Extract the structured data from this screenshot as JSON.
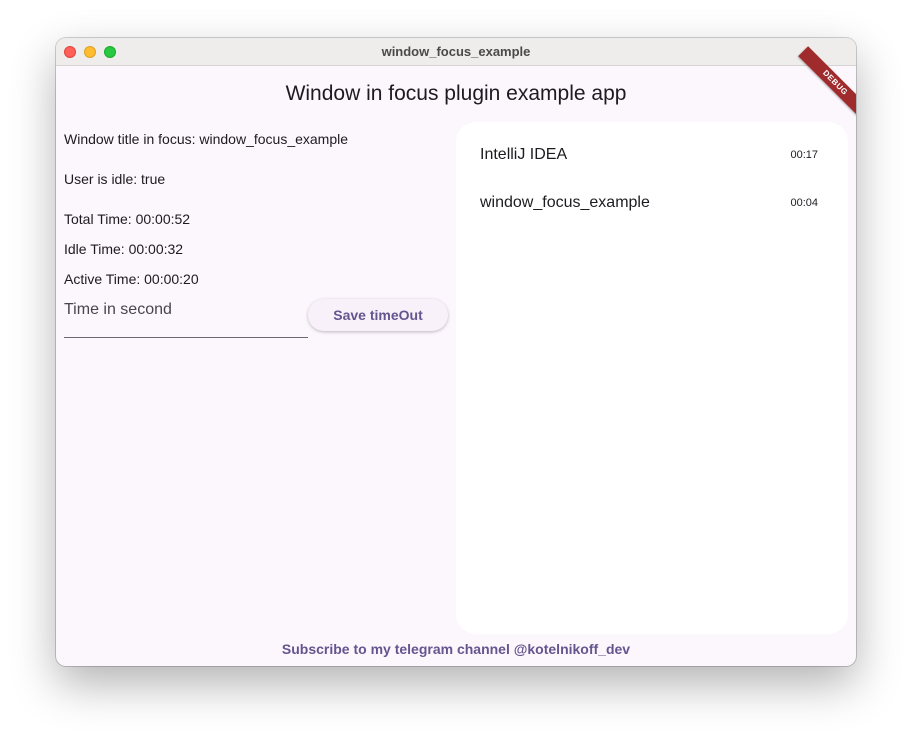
{
  "window": {
    "title": "window_focus_example"
  },
  "app": {
    "title": "Window in focus plugin example app",
    "debug_banner": "DEBUG"
  },
  "info": {
    "window_title": "Window title in focus: window_focus_example",
    "user_idle": "User is idle: true",
    "total_time": "Total Time: 00:00:52",
    "idle_time": "Idle Time: 00:00:32",
    "active_time": "Active Time: 00:00:20"
  },
  "timeout": {
    "placeholder": "Time in second",
    "value": "",
    "save_label": "Save timeOut"
  },
  "apps_list": [
    {
      "name": "IntelliJ IDEA",
      "time": "00:17"
    },
    {
      "name": "window_focus_example",
      "time": "00:04"
    }
  ],
  "footer": {
    "link": "Subscribe to my telegram channel @kotelnikoff_dev"
  },
  "colors": {
    "accent": "#65558f",
    "background": "#fcf6fd",
    "debug_banner": "#a02b2d"
  }
}
